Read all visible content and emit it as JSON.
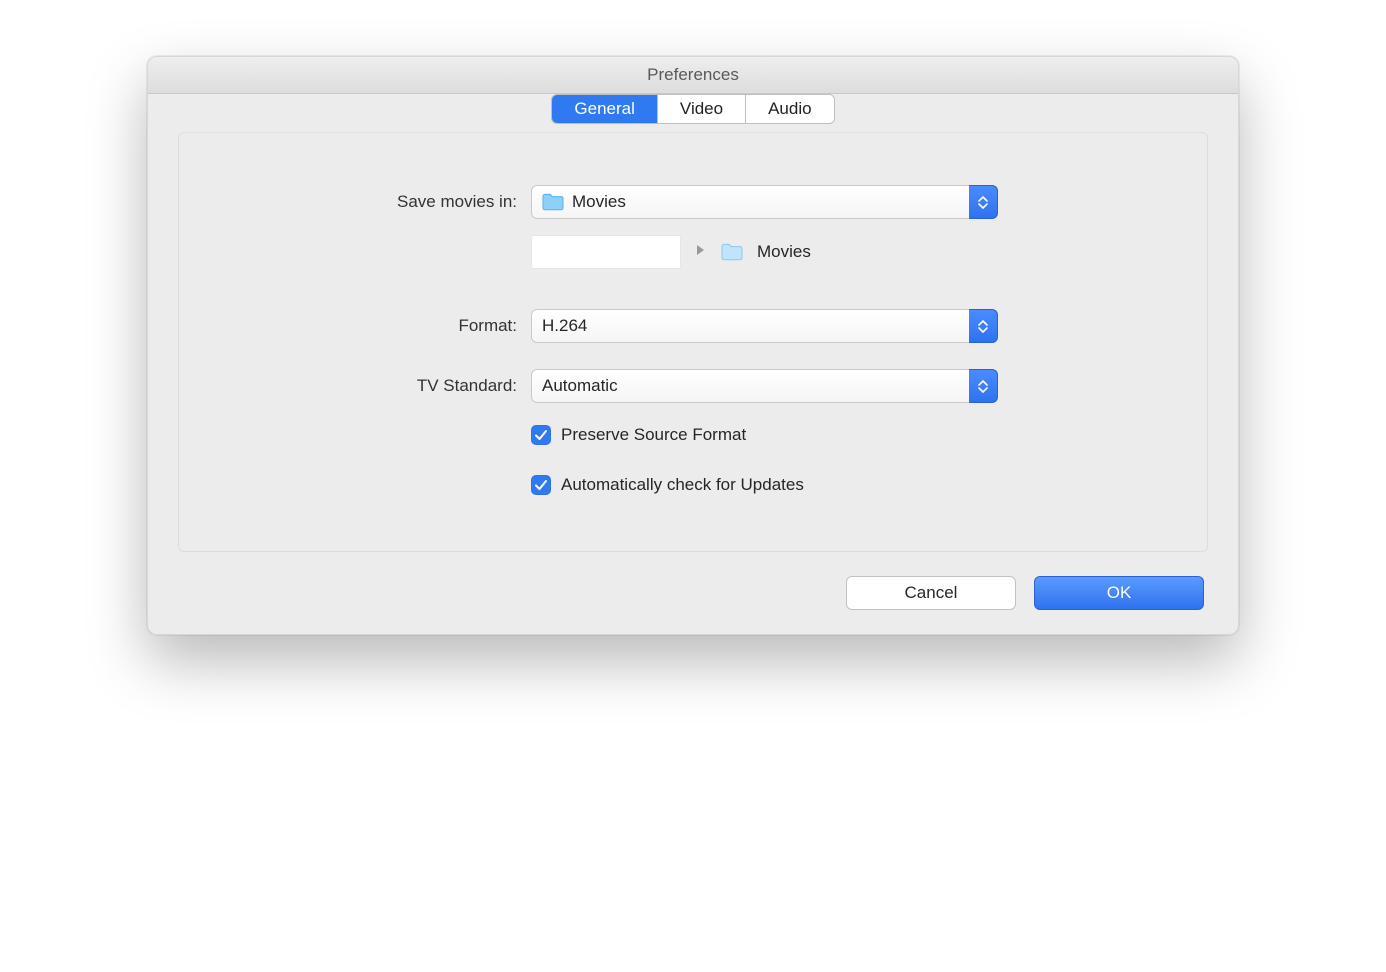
{
  "window": {
    "title": "Preferences"
  },
  "tabs": {
    "general": "General",
    "video": "Video",
    "audio": "Audio",
    "active": "general"
  },
  "general": {
    "save_label": "Save movies in:",
    "save_location": "Movies",
    "path_current": "Movies",
    "format_label": "Format:",
    "format_value": "H.264",
    "tvstd_label": "TV Standard:",
    "tvstd_value": "Automatic",
    "preserve_label": "Preserve Source Format",
    "preserve_checked": true,
    "updates_label": "Automatically check for Updates",
    "updates_checked": true
  },
  "footer": {
    "cancel": "Cancel",
    "ok": "OK"
  },
  "icons": {
    "folder": "folder-icon",
    "chevron": "chevron-right-icon",
    "up_down": "popup-arrows-icon",
    "check": "checkmark-icon"
  }
}
